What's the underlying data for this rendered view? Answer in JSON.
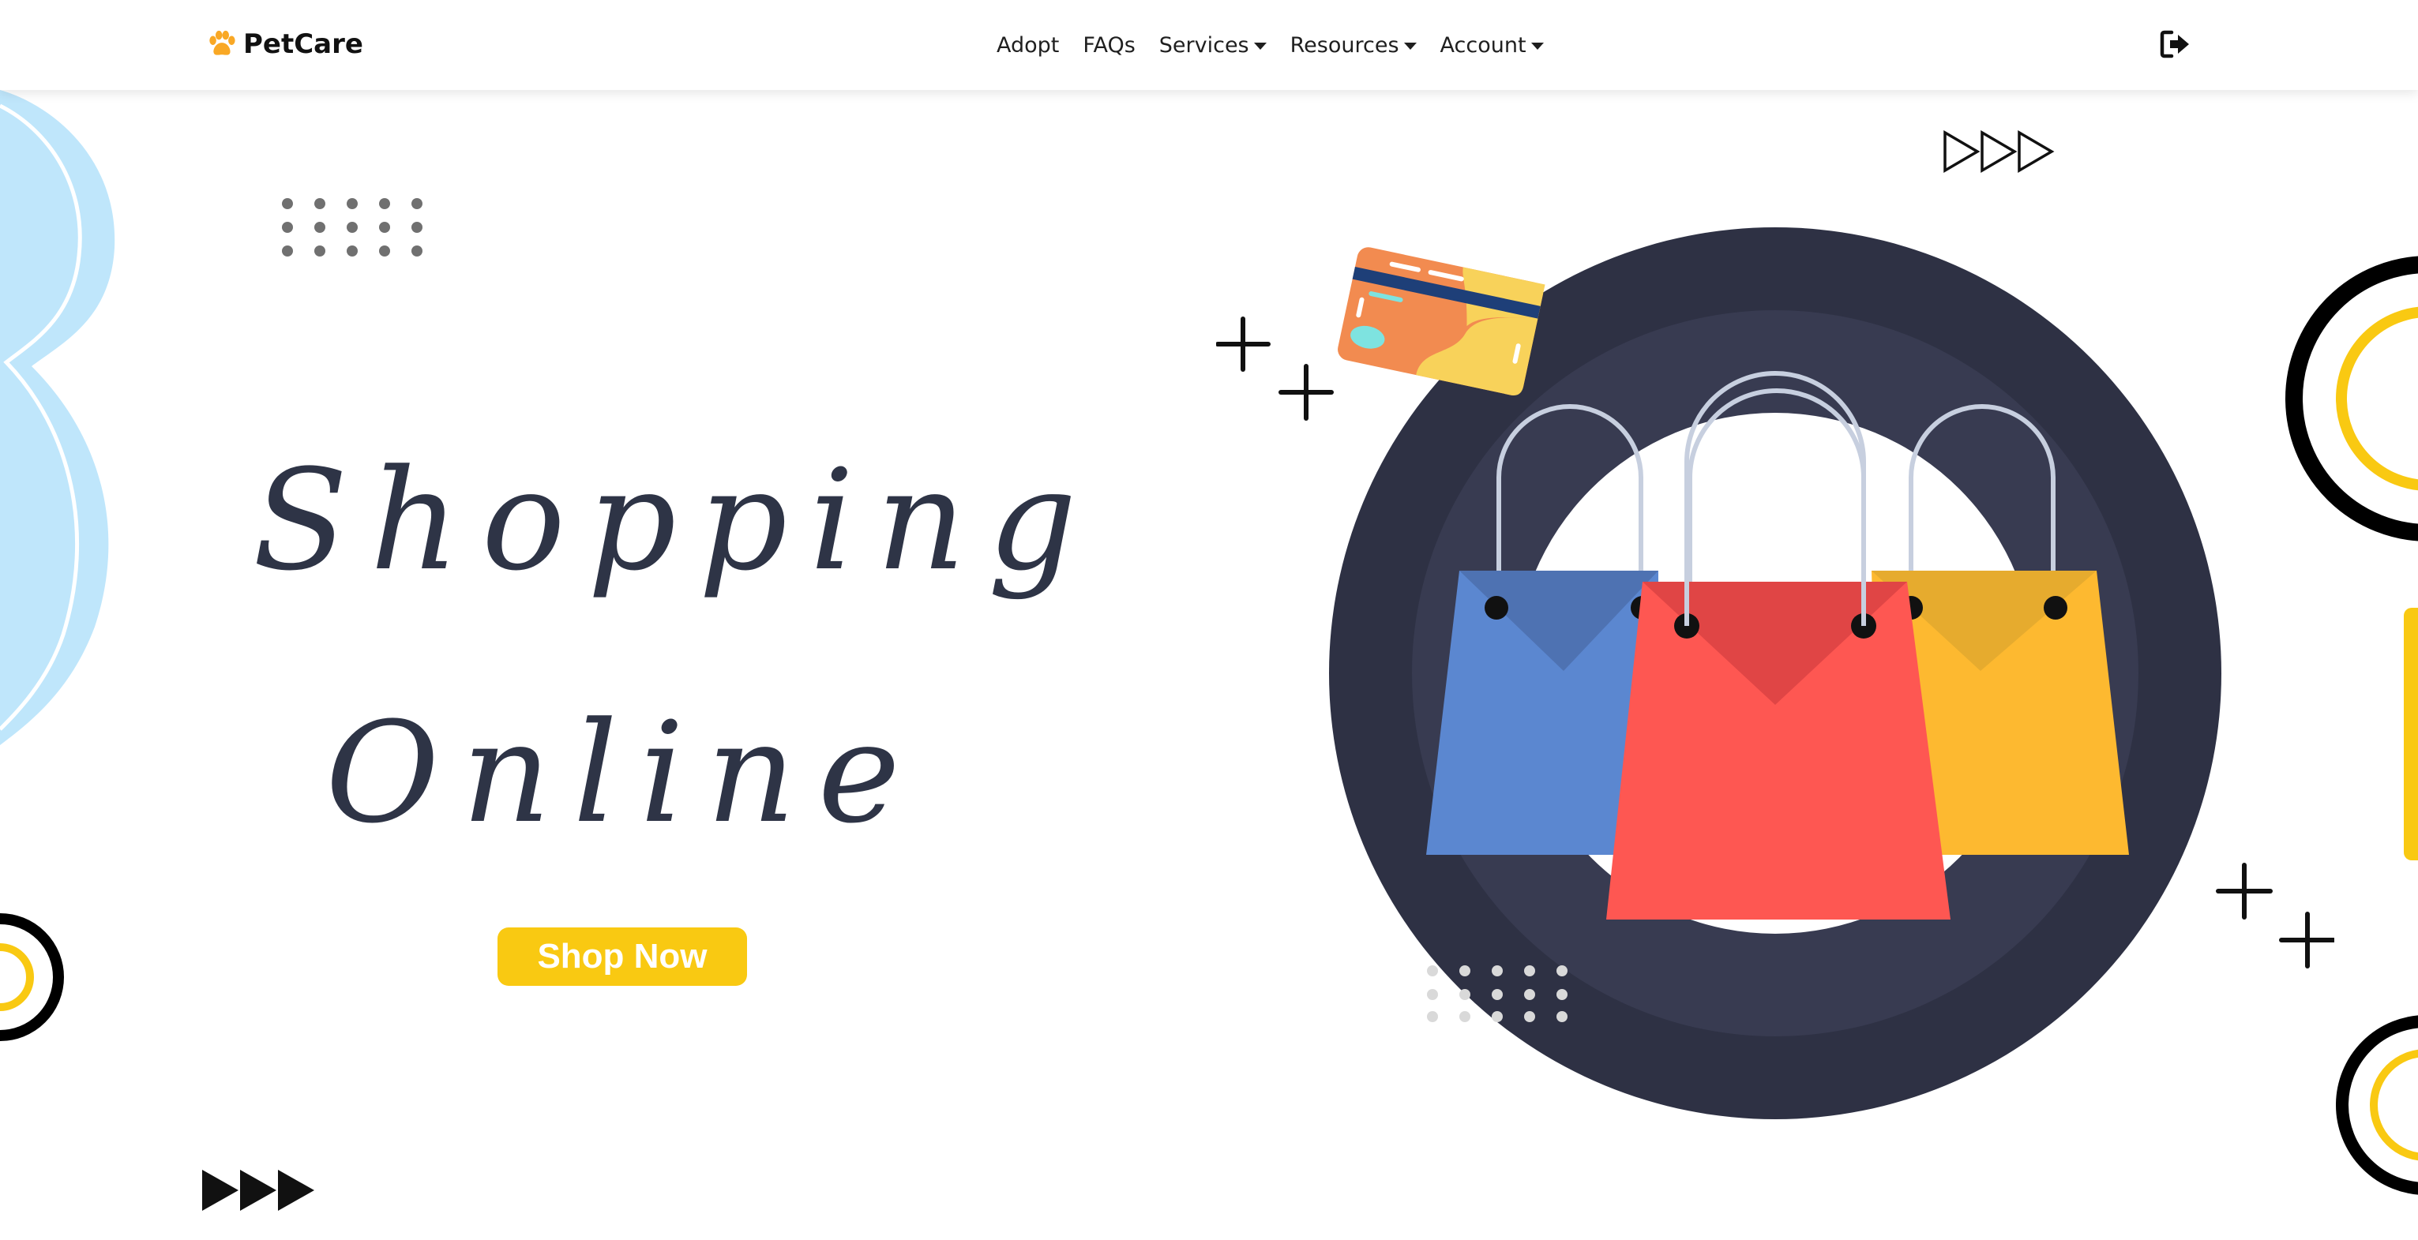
{
  "brand": {
    "name": "PetCare",
    "icon": "paw-icon",
    "icon_color": "#f9a825"
  },
  "nav": {
    "items": [
      {
        "label": "Adopt",
        "dropdown": false
      },
      {
        "label": "FAQs",
        "dropdown": false
      },
      {
        "label": "Services",
        "dropdown": true
      },
      {
        "label": "Resources",
        "dropdown": true
      },
      {
        "label": "Account",
        "dropdown": true
      }
    ],
    "logout_icon": "sign-out-icon"
  },
  "hero": {
    "title_line1": "Shopping",
    "title_line2": "Online",
    "cta_label": "Shop Now"
  },
  "colors": {
    "accent_yellow": "#f9c912",
    "title_color": "#2e3446",
    "circle_dark": "#2e3144",
    "bag_blue": "#5b87d0",
    "bag_red": "#fe5752",
    "bag_yellow": "#fdb930",
    "blob_blue": "#bfe6fb"
  }
}
